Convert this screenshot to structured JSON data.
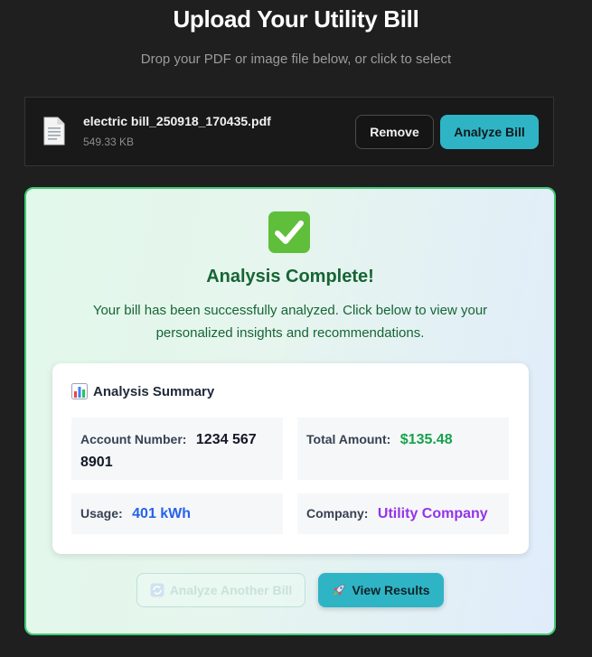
{
  "header": {
    "title": "Upload Your Utility Bill",
    "subtitle": "Drop your PDF or image file below, or click to select"
  },
  "file": {
    "icon": "document-icon",
    "name": "electric bill_250918_170435.pdf",
    "size": "549.33 KB",
    "remove_label": "Remove",
    "analyze_label": "Analyze Bill"
  },
  "result": {
    "icon": "check-mark-icon",
    "title": "Analysis Complete!",
    "description": "Your bill has been successfully analyzed. Click below to view your personalized insights and recommendations.",
    "summary": {
      "icon": "bar-chart-icon",
      "title": "Analysis Summary",
      "account_label": "Account Number:",
      "account_value": "1234 567 8901",
      "total_label": "Total Amount:",
      "total_value": "$135.48",
      "usage_label": "Usage:",
      "usage_value": "401 kWh",
      "company_label": "Company:",
      "company_value": "Utility Company"
    },
    "another_label": "Analyze Another Bill",
    "view_label": "View Results"
  },
  "colors": {
    "accent": "#2fb4c6",
    "success": "#166534",
    "success_border": "#41c975",
    "amount_green": "#16a34a",
    "usage_blue": "#2563eb",
    "company_purple": "#9333ea"
  }
}
